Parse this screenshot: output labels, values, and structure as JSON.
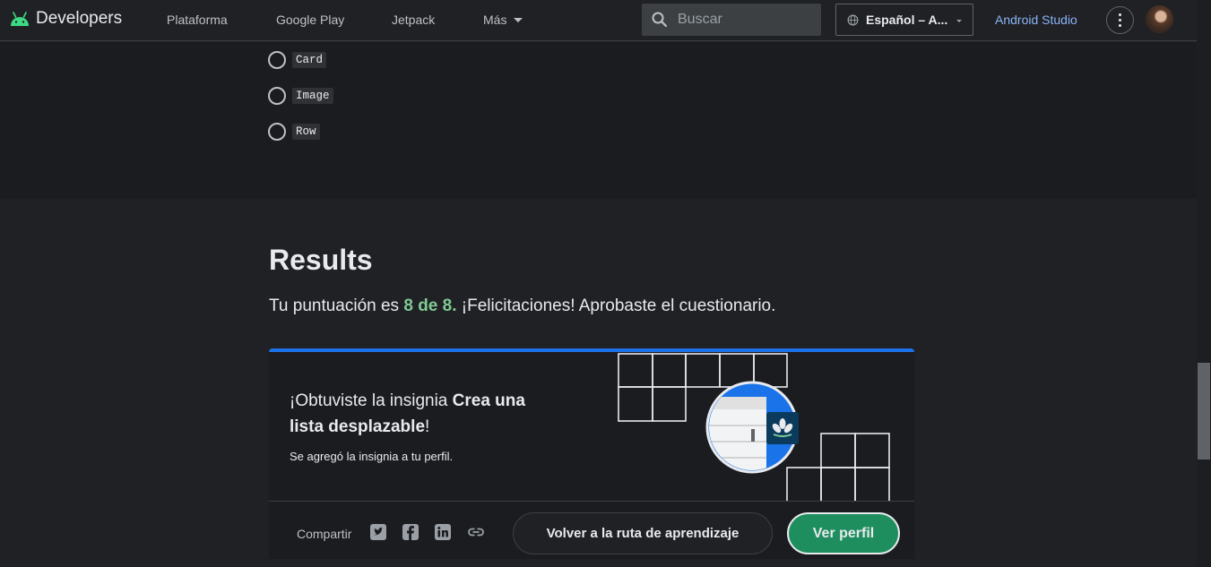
{
  "nav": {
    "logo_text": "Developers",
    "items": [
      "Plataforma",
      "Google Play",
      "Jetpack",
      "Más"
    ],
    "search_placeholder": "Buscar",
    "language": "Español – A...",
    "studio_link": "Android Studio"
  },
  "quiz": {
    "options": [
      "Card",
      "Image",
      "Row"
    ]
  },
  "results": {
    "title": "Results",
    "score_prefix": "Tu puntuación es ",
    "score": "8 de 8.",
    "score_suffix": " ¡Felicitaciones! Aprobaste el cuestionario."
  },
  "badge": {
    "title_prefix": "¡Obtuviste la insignia ",
    "title_bold_1": "Crea una",
    "title_bold_2": "lista desplazable",
    "title_suffix": "!",
    "subtitle": "Se agregó la insignia a tu perfil.",
    "share_label": "Compartir",
    "share_icons": [
      "twitter-icon",
      "facebook-icon",
      "linkedin-icon",
      "link-icon"
    ],
    "back_button": "Volver a la ruta de aprendizaje",
    "profile_button": "Ver perfil"
  },
  "colors": {
    "accent_blue": "#1a73e8",
    "score_green": "#81c995",
    "profile_button": "#1e8e5e",
    "link_blue": "#8ab4f8"
  }
}
